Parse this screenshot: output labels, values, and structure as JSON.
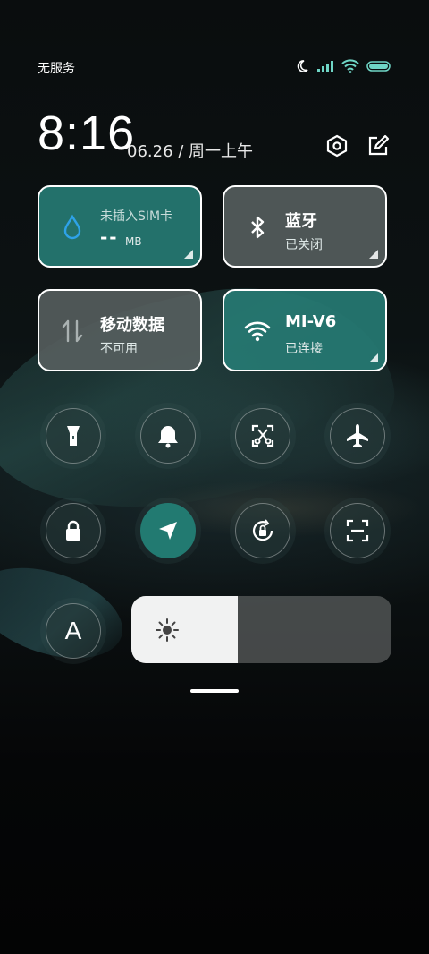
{
  "status": {
    "carrier": "无服务"
  },
  "header": {
    "time": "8:16",
    "date": "06.26 / 周一上午"
  },
  "tiles": {
    "data_usage": {
      "label": "未插入SIM卡",
      "value": "--",
      "unit": "MB"
    },
    "bluetooth": {
      "label": "蓝牙",
      "status": "已关闭"
    },
    "mobile_data": {
      "label": "移动数据",
      "status": "不可用"
    },
    "wifi": {
      "label": "MI-V6",
      "status": "已连接"
    }
  },
  "toggles_row1": [
    "flashlight-icon",
    "bell-icon",
    "screenshot-icon",
    "airplane-icon"
  ],
  "toggles_row2": [
    "lock-icon",
    "location-icon",
    "auto-rotate-icon",
    "scan-icon"
  ],
  "auto_brightness": {
    "label": "A"
  },
  "brightness": {
    "level": 0.41
  },
  "colors": {
    "accent": "#227a71",
    "tile_off": "#586060"
  }
}
